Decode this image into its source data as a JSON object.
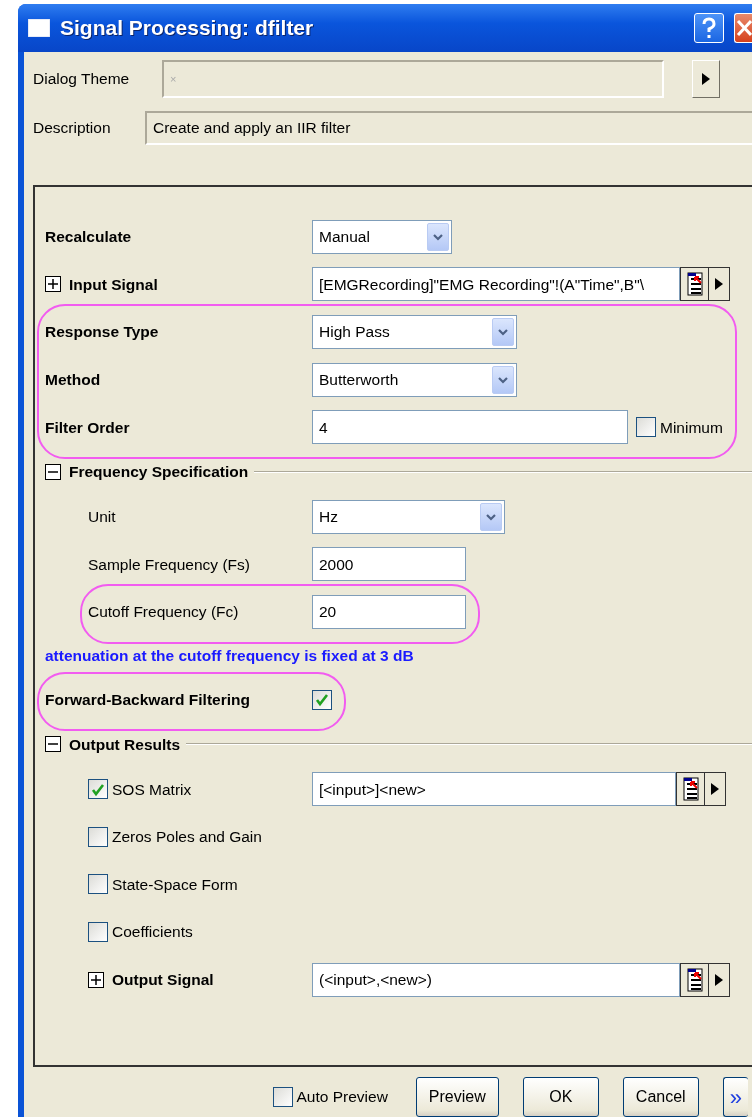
{
  "window": {
    "title": "Signal Processing: dfilter"
  },
  "dialog_theme": {
    "label": "Dialog Theme",
    "placeholder": "×"
  },
  "description": {
    "label": "Description",
    "value": "Create and apply an IIR filter"
  },
  "settings": [
    {
      "kind": "combo",
      "label": "Recalculate",
      "bold": true,
      "value": "Manual",
      "highlighted": false
    },
    {
      "kind": "picker",
      "label": "Input Signal",
      "bold": true,
      "expanded": false,
      "value": "[EMGRecording]\"EMG Recording\"!(A\"Time\",B\"\\",
      "highlighted": false
    },
    {
      "kind": "combo",
      "label": "Response Type",
      "bold": true,
      "value": "High Pass",
      "highlighted": true
    },
    {
      "kind": "combo",
      "label": "Method",
      "bold": true,
      "value": "Butterworth",
      "highlighted": true
    },
    {
      "kind": "input",
      "label": "Filter Order",
      "bold": true,
      "value": "4",
      "option": {
        "label": "Minimum",
        "checked": false
      },
      "highlighted": true
    },
    {
      "kind": "section",
      "label": "Frequency Specification",
      "expanded": true,
      "children": [
        {
          "kind": "combo",
          "label": "Unit",
          "bold": false,
          "value": "Hz",
          "highlighted": false
        },
        {
          "kind": "input",
          "label": "Sample Frequency (Fs)",
          "bold": false,
          "value": "2000",
          "highlighted": false
        },
        {
          "kind": "input",
          "label": "Cutoff Frequency (Fc)",
          "bold": false,
          "value": "20",
          "highlighted": true
        }
      ]
    },
    {
      "kind": "note",
      "text": "attenuation at the cutoff frequency is fixed at 3 dB",
      "highlighted": false
    },
    {
      "kind": "toggle",
      "label": "Forward-Backward Filtering",
      "bold": true,
      "checked": true,
      "highlighted": true
    },
    {
      "kind": "section",
      "label": "Output Results",
      "expanded": true,
      "children": [
        {
          "kind": "checkpicker",
          "label": "SOS Matrix",
          "checked": true,
          "value": "[<input>]<new>",
          "highlighted": false
        },
        {
          "kind": "checkbox",
          "label": "Zeros Poles and Gain",
          "checked": false,
          "highlighted": false
        },
        {
          "kind": "checkbox",
          "label": "State-Space Form",
          "checked": false,
          "highlighted": false
        },
        {
          "kind": "checkbox",
          "label": "Coefficients",
          "checked": false,
          "highlighted": false
        },
        {
          "kind": "picker",
          "label": "Output Signal",
          "bold": true,
          "expanded": false,
          "value": "(<input>,<new>)",
          "highlighted": false
        }
      ]
    }
  ],
  "footer": {
    "auto_preview": {
      "label": "Auto Preview",
      "checked": false
    },
    "buttons": [
      "Preview",
      "OK",
      "Cancel"
    ],
    "more": "»"
  }
}
